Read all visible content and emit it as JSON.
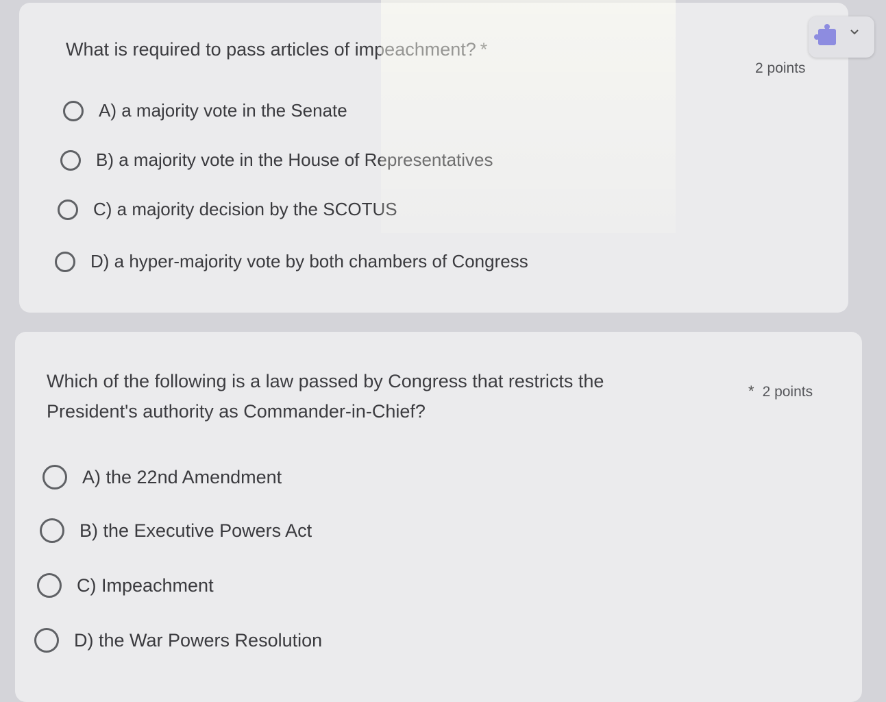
{
  "questions": [
    {
      "text": "What is required to pass articles of impeachment?",
      "required_mark": "*",
      "points": "2 points",
      "options": [
        "A) a majority vote in the Senate",
        "B) a majority vote in the House of Representatives",
        "C) a majority decision by the SCOTUS",
        "D) a hyper-majority vote by both chambers of Congress"
      ]
    },
    {
      "text_line1": "Which of the following is a law passed by Congress that restricts the",
      "text_line2": "President's authority as Commander-in-Chief?",
      "required_mark": "*",
      "points": "2 points",
      "options": [
        "A) the 22nd Amendment",
        "B) the Executive Powers Act",
        "C) Impeachment",
        "D) the War Powers Resolution"
      ]
    }
  ],
  "extension_widget": {
    "icon": "puzzle-extension-icon",
    "chevron": "chevron-down-icon",
    "accent_color": "#8d8ce0"
  }
}
